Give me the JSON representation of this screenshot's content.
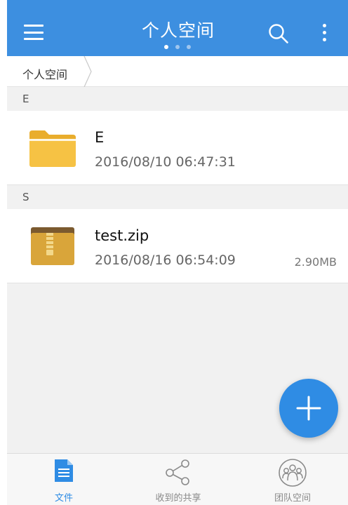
{
  "header": {
    "title": "个人空间",
    "page_dots": [
      true,
      false,
      false
    ]
  },
  "breadcrumb": {
    "items": [
      "个人空间"
    ]
  },
  "sections": [
    {
      "letter": "E",
      "files": [
        {
          "name": "E",
          "date": "2016/08/10 06:47:31",
          "size": "",
          "icon": "folder-icon"
        }
      ]
    },
    {
      "letter": "S",
      "files": [
        {
          "name": "test.zip",
          "date": "2016/08/16 06:54:09",
          "size": "2.90MB",
          "icon": "zip-archive-icon"
        }
      ]
    }
  ],
  "fab": {
    "icon": "plus-icon"
  },
  "tabbar": {
    "tabs": [
      {
        "label": "文件",
        "icon": "document-icon",
        "active": true
      },
      {
        "label": "收到的共享",
        "icon": "share-icon",
        "active": false
      },
      {
        "label": "团队空间",
        "icon": "team-icon",
        "active": false
      }
    ]
  },
  "colors": {
    "header": "#3d8fe0",
    "accent": "#2f8ce4",
    "folder": "#f6c244",
    "zip_brown": "#7b5a2f",
    "zip_gold": "#d9a53a"
  }
}
